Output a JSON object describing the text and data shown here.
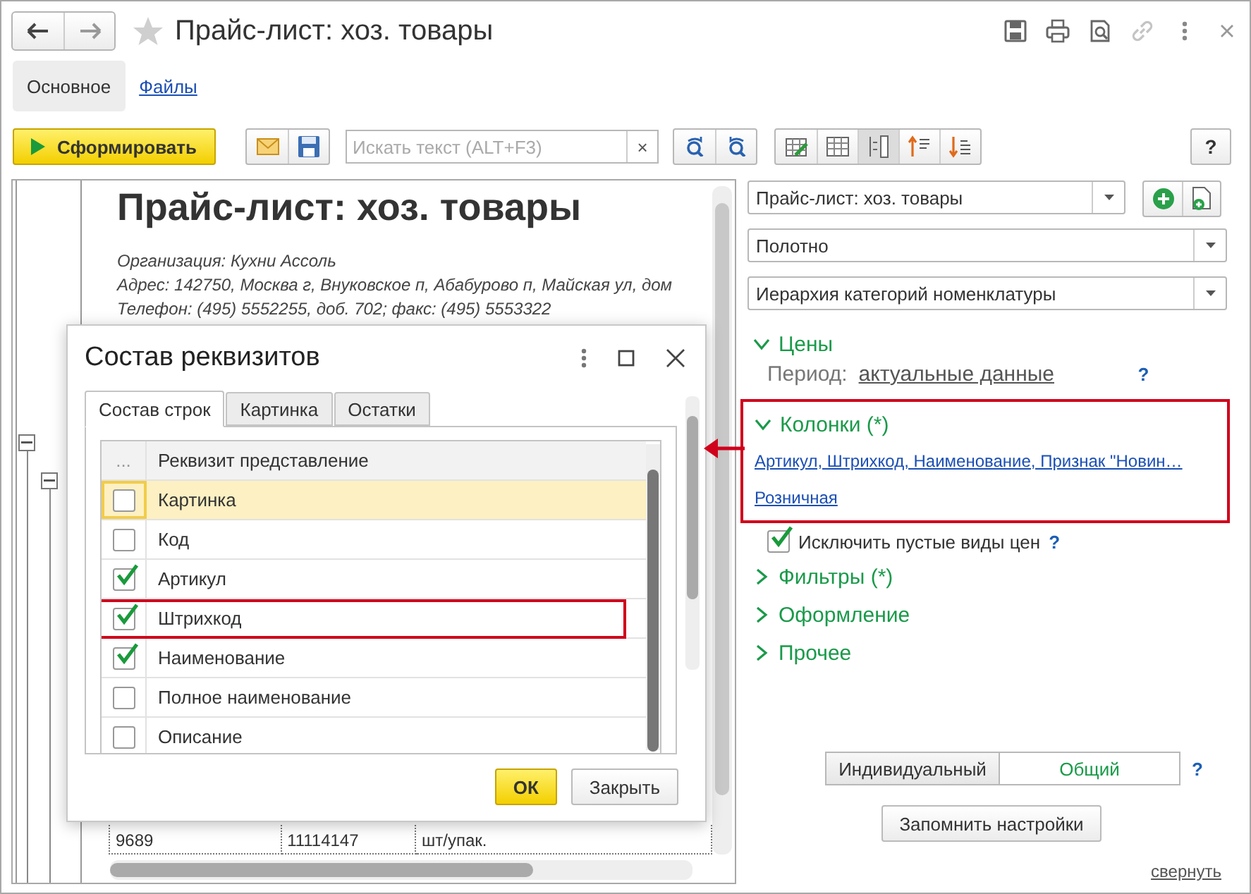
{
  "window": {
    "title": "Прайс-лист: хоз. товары"
  },
  "tabs": [
    {
      "label": "Основное",
      "selected": true
    },
    {
      "label": "Файлы",
      "selected": false
    }
  ],
  "toolbar": {
    "generate_button": "Сформировать",
    "search": {
      "placeholder": "Искать текст (ALT+F3)"
    },
    "clear_button": "×",
    "help_button": "?"
  },
  "report": {
    "title": "Прайс-лист: хоз. товары",
    "details": [
      "Организация: Кухни Ассоль",
      "Адрес: 142750, Москва г, Внуковское п, Абабурово п, Майская ул, дом",
      "Телефон: (495) 5552255, доб. 702; факс: (495) 5553322"
    ],
    "rows": [
      {
        "cells": [
          "9689",
          "11114147",
          "шт/упак."
        ]
      }
    ]
  },
  "dialog": {
    "title": "Состав реквизитов",
    "tabs": [
      {
        "label": "Состав строк",
        "selected": true
      },
      {
        "label": "Картинка",
        "selected": false
      },
      {
        "label": "Остатки",
        "selected": false
      }
    ],
    "columns": [
      "...",
      "Реквизит представление"
    ],
    "rows": [
      {
        "label": "Картинка",
        "checked": false,
        "selected": true,
        "highlighted": false
      },
      {
        "label": "Код",
        "checked": false,
        "selected": false,
        "highlighted": false
      },
      {
        "label": "Артикул",
        "checked": true,
        "selected": false,
        "highlighted": false
      },
      {
        "label": "Штрихкод",
        "checked": true,
        "selected": false,
        "highlighted": true
      },
      {
        "label": "Наименование",
        "checked": true,
        "selected": false,
        "highlighted": false
      },
      {
        "label": "Полное наименование",
        "checked": false,
        "selected": false,
        "highlighted": false
      },
      {
        "label": "Описание",
        "checked": false,
        "selected": false,
        "highlighted": false
      }
    ],
    "buttons": [
      {
        "label": "ОК",
        "kind": "primary"
      },
      {
        "label": "Закрыть",
        "kind": "default"
      }
    ]
  },
  "settings": {
    "variant": "Прайс-лист: хоз. товары",
    "dropdowns": [
      "Полотно",
      "Иерархия категорий номенклатуры"
    ],
    "sections": [
      {
        "title": "Цены",
        "expanded": true,
        "highlighted": false,
        "period_label": "Период:",
        "period_value": "актуальные данные",
        "help": "?"
      },
      {
        "title": "Колонки (*)",
        "expanded": true,
        "highlighted": true,
        "links": [
          "Артикул, Штрихкод, Наименование, Признак \"Новин…",
          "Розничная"
        ]
      },
      {
        "title": "Фильтры (*)",
        "expanded": false,
        "highlighted": false
      },
      {
        "title": "Оформление",
        "expanded": false,
        "highlighted": false
      },
      {
        "title": "Прочее",
        "expanded": false,
        "highlighted": false
      }
    ],
    "exclude_empty": {
      "label": "Исключить пустые виды цен",
      "checked": true,
      "help": "?"
    },
    "mode": [
      {
        "label": "Индивидуальный",
        "selected": false
      },
      {
        "label": "Общий",
        "selected": true
      }
    ],
    "mode_help": "?",
    "save_button": "Запомнить настройки",
    "collapse_link": "свернуть"
  }
}
